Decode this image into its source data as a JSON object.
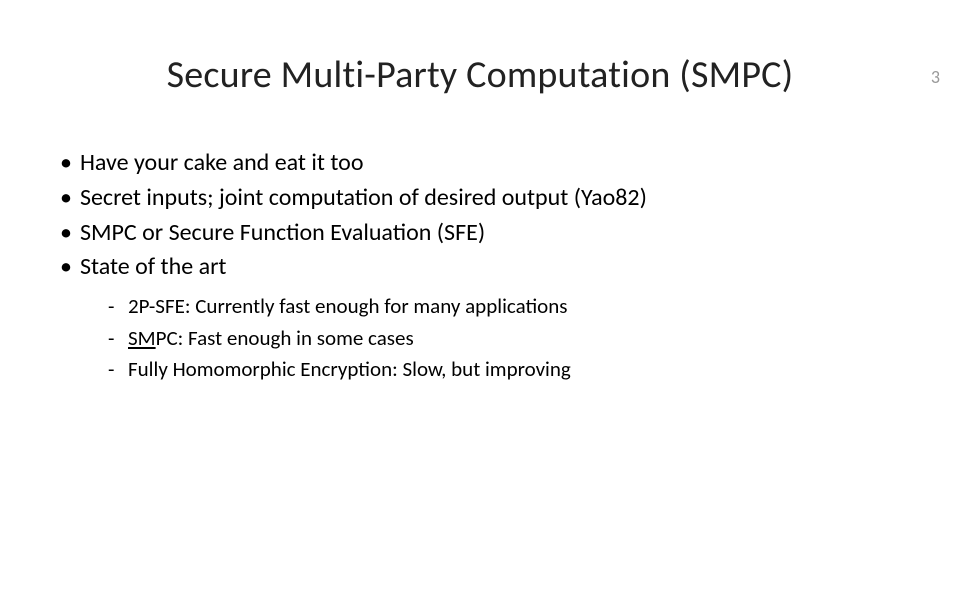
{
  "pageNumber": "3",
  "title": "Secure Multi-Party Computation (SMPC)",
  "bullets": [
    {
      "text": "Have your cake and eat it too"
    },
    {
      "text": "Secret inputs; joint computation of desired output (Yao82)"
    },
    {
      "text": "SMPC or Secure Function Evaluation (SFE)"
    },
    {
      "text": "State of the art"
    }
  ],
  "subBullets": [
    {
      "text": "2P-SFE: Currently fast enough for many applications",
      "underlinePrefix": null
    },
    {
      "text": "PC: Fast enough in some cases",
      "underlinePrefix": "SM"
    },
    {
      "text": "Fully Homomorphic Encryption: Slow, but improving",
      "underlinePrefix": null
    }
  ]
}
